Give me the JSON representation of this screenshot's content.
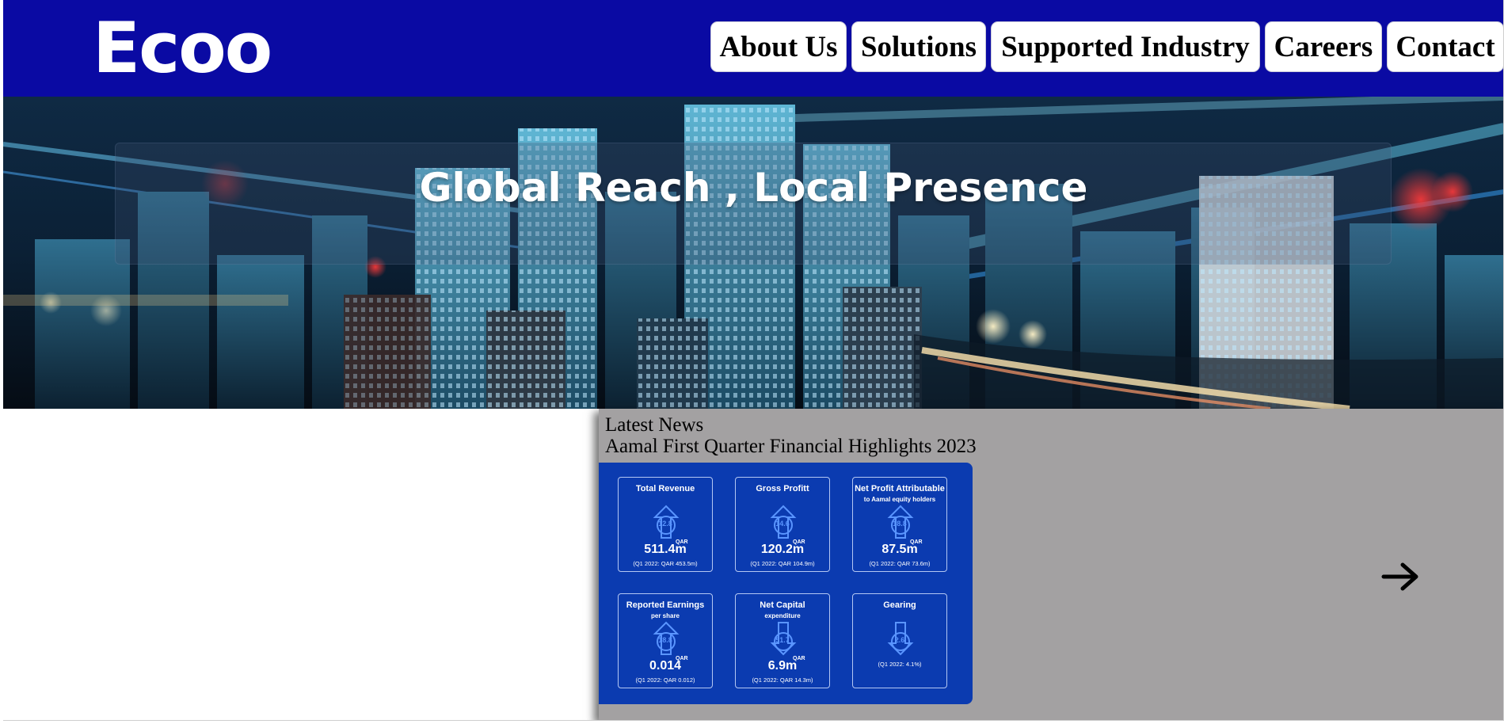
{
  "header": {
    "logo": "Ecoo",
    "brand_color": "#0a0aa3",
    "nav": [
      {
        "label": "About Us"
      },
      {
        "label": "Solutions"
      },
      {
        "label": "Supported Industry"
      },
      {
        "label": "Careers"
      },
      {
        "label": "Contact"
      }
    ]
  },
  "hero": {
    "title": "Global Reach , Local Presence"
  },
  "news": {
    "heading": "Latest News",
    "title": "Aamal First Quarter Financial Highlights 2023",
    "next_icon": "arrow-right-icon",
    "highlights": [
      {
        "title": "Total Revenue",
        "subtitle": "",
        "percent": "12.8",
        "direction": "up",
        "currency": "QAR",
        "value": "511.4m",
        "previous": "(Q1 2022: QAR 453.5m)"
      },
      {
        "title": "Gross Profitt",
        "subtitle": "",
        "percent": "14.6",
        "direction": "up",
        "currency": "QAR",
        "value": "120.2m",
        "previous": "(Q1 2022: QAR 104.9m)"
      },
      {
        "title": "Net Profit Attributable",
        "subtitle": "to Aamal equity holders",
        "percent": "18.8",
        "direction": "up",
        "currency": "QAR",
        "value": "87.5m",
        "previous": "(Q1 2022: QAR 73.6m)"
      },
      {
        "title": "Reported Earnings",
        "subtitle": "per share",
        "percent": "18.8",
        "direction": "up",
        "currency": "QAR",
        "value": "0.014",
        "previous": "(Q1 2022: QAR 0.012)"
      },
      {
        "title": "Net Capital",
        "subtitle": "expenditure",
        "percent": "51.7",
        "direction": "down",
        "currency": "QAR",
        "value": "6.9m",
        "previous": "(Q1 2022: QAR 14.3m)"
      },
      {
        "title": "Gearing",
        "subtitle": "",
        "percent": "2.6",
        "direction": "down",
        "currency": "",
        "value": "",
        "previous": "(Q1 2022: 4.1%)"
      }
    ]
  }
}
